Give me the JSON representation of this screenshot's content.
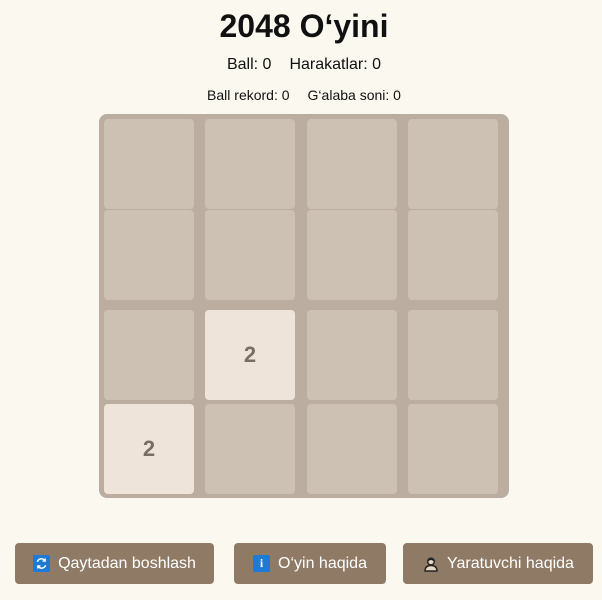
{
  "title": "2048 O‘yini",
  "scores": {
    "ball_label": "Ball:",
    "ball_value": "0",
    "moves_label": "Harakatlar:",
    "moves_value": "0"
  },
  "stats": {
    "record_label": "Ball rekord:",
    "record_value": "0",
    "wins_label": "G‘alaba soni:",
    "wins_value": "0"
  },
  "board": {
    "rows": 4,
    "cols": 4,
    "tiles": [
      [
        "",
        "",
        "",
        ""
      ],
      [
        "",
        "",
        "",
        ""
      ],
      [
        "",
        "2",
        "",
        ""
      ],
      [
        "2",
        "",
        "",
        ""
      ]
    ]
  },
  "buttons": {
    "restart": {
      "label": "Qaytadan boshlash",
      "icon": "refresh-icon"
    },
    "about_game": {
      "label": "O‘yin haqida",
      "icon": "info-icon"
    },
    "about_creator": {
      "label": "Yaratuvchi haqida",
      "icon": "person-icon"
    }
  },
  "colors": {
    "background": "#faf8ef",
    "board": "#bbada0",
    "empty_cell": "#cdc1b4",
    "tile_2": "#eee4da",
    "tile_text": "#776e65",
    "button": "#8f7a66",
    "icon_blue": "#1f7ad6"
  }
}
